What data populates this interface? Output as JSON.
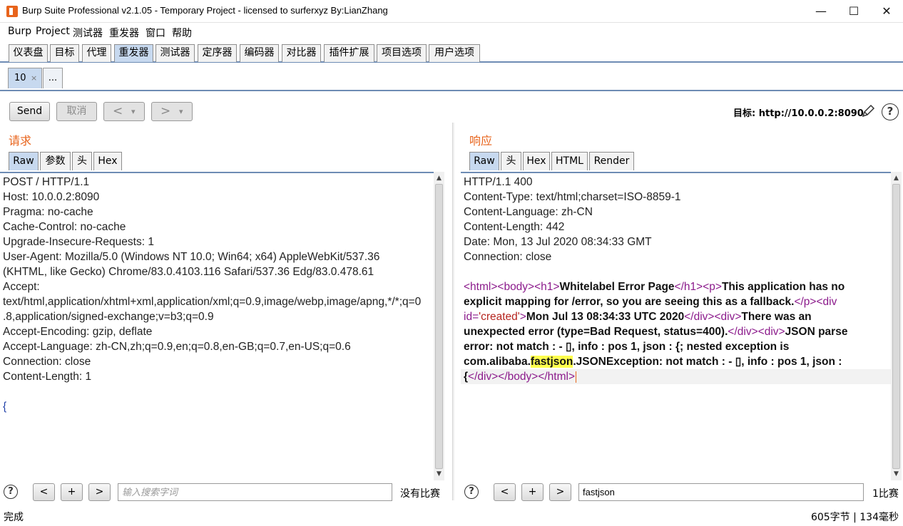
{
  "window": {
    "title": "Burp Suite Professional v2.1.05 - Temporary Project - licensed to surferxyz By:LianZhang",
    "minimize": "—",
    "maximize": "☐",
    "close": "✕"
  },
  "menu": [
    "Burp",
    "Project",
    "测试器",
    "重发器",
    "窗口",
    "帮助"
  ],
  "main_tabs": [
    "仪表盘",
    "目标",
    "代理",
    "重发器",
    "测试器",
    "定序器",
    "编码器",
    "对比器",
    "插件扩展",
    "项目选项",
    "用户选项"
  ],
  "sub_tabs": {
    "active": "10",
    "close": "×",
    "more": "..."
  },
  "toolbar": {
    "send": "Send",
    "cancel": "取消",
    "back": "<",
    "back_drop": "▾",
    "forward": ">",
    "forward_drop": "▾",
    "target_label": "目标:",
    "target_url": "http://10.0.0.2:8090",
    "help": "?"
  },
  "request": {
    "title": "请求",
    "tabs": [
      "Raw",
      "参数",
      "头",
      "Hex"
    ],
    "lines": [
      "POST / HTTP/1.1",
      "Host: 10.0.0.2:8090",
      "Pragma: no-cache",
      "Cache-Control: no-cache",
      "Upgrade-Insecure-Requests: 1",
      "User-Agent: Mozilla/5.0 (Windows NT 10.0; Win64; x64) AppleWebKit/537.36",
      "(KHTML, like Gecko) Chrome/83.0.4103.116 Safari/537.36 Edg/83.0.478.61",
      "Accept:",
      "text/html,application/xhtml+xml,application/xml;q=0.9,image/webp,image/apng,*/*;q=0",
      ".8,application/signed-exchange;v=b3;q=0.9",
      "Accept-Encoding: gzip, deflate",
      "Accept-Language: zh-CN,zh;q=0.9,en;q=0.8,en-GB;q=0.7,en-US;q=0.6",
      "Connection: close",
      "Content-Length: 1",
      "",
      "{"
    ],
    "search": {
      "help": "?",
      "prev": "<",
      "add": "+",
      "next": ">",
      "placeholder": "输入搜索字词",
      "value": "",
      "matches": "没有比赛"
    }
  },
  "response": {
    "title": "响应",
    "tabs": [
      "Raw",
      "头",
      "Hex",
      "HTML",
      "Render"
    ],
    "header_lines": [
      "HTTP/1.1 400",
      "Content-Type: text/html;charset=ISO-8859-1",
      "Content-Language: zh-CN",
      "Content-Length: 442",
      "Date: Mon, 13 Jul 2020 08:34:33 GMT",
      "Connection: close"
    ],
    "body": {
      "t_html": "<html>",
      "t_body": "<body>",
      "t_h1": "<h1>",
      "h1_text": "Whitelabel Error Page",
      "t_h1_close": "</h1>",
      "t_p": "<p>",
      "p_text_1": "This application has no",
      "p_text_2": "explicit mapping for /error, so you are seeing this as a fallback.",
      "t_p_close": "</p>",
      "t_div_open": "<div",
      "attr_id": "id=",
      "attr_val": "'created'",
      "gt": ">",
      "date_text": "Mon Jul 13 08:34:33 UTC 2020",
      "t_div_close": "</div>",
      "t_div": "<div>",
      "err_1": "There was an",
      "err_2": "unexpected error (type=Bad Request, status=400).",
      "json_1": "JSON parse",
      "json_2": "error: not match : - ▯, info : pos 1, json : {; nested exception is",
      "json_3a": "com.alibaba.",
      "json_3_hl": "fastjson",
      "json_3b": ".JSONException: not match : - ▯, info : pos 1, json :",
      "json_4": "{",
      "t_body_close": "</body>",
      "t_html_close": "</html>"
    },
    "search": {
      "help": "?",
      "prev": "<",
      "add": "+",
      "next": ">",
      "placeholder": "",
      "value": "fastjson",
      "matches": "1比赛"
    }
  },
  "status": {
    "left": "完成",
    "right": "605字节 | 134毫秒"
  },
  "colors": {
    "accent": "#e8641c",
    "tab_active": "#c7d9ef",
    "highlight": "#ffff4d",
    "tag": "#8b1a8b"
  }
}
